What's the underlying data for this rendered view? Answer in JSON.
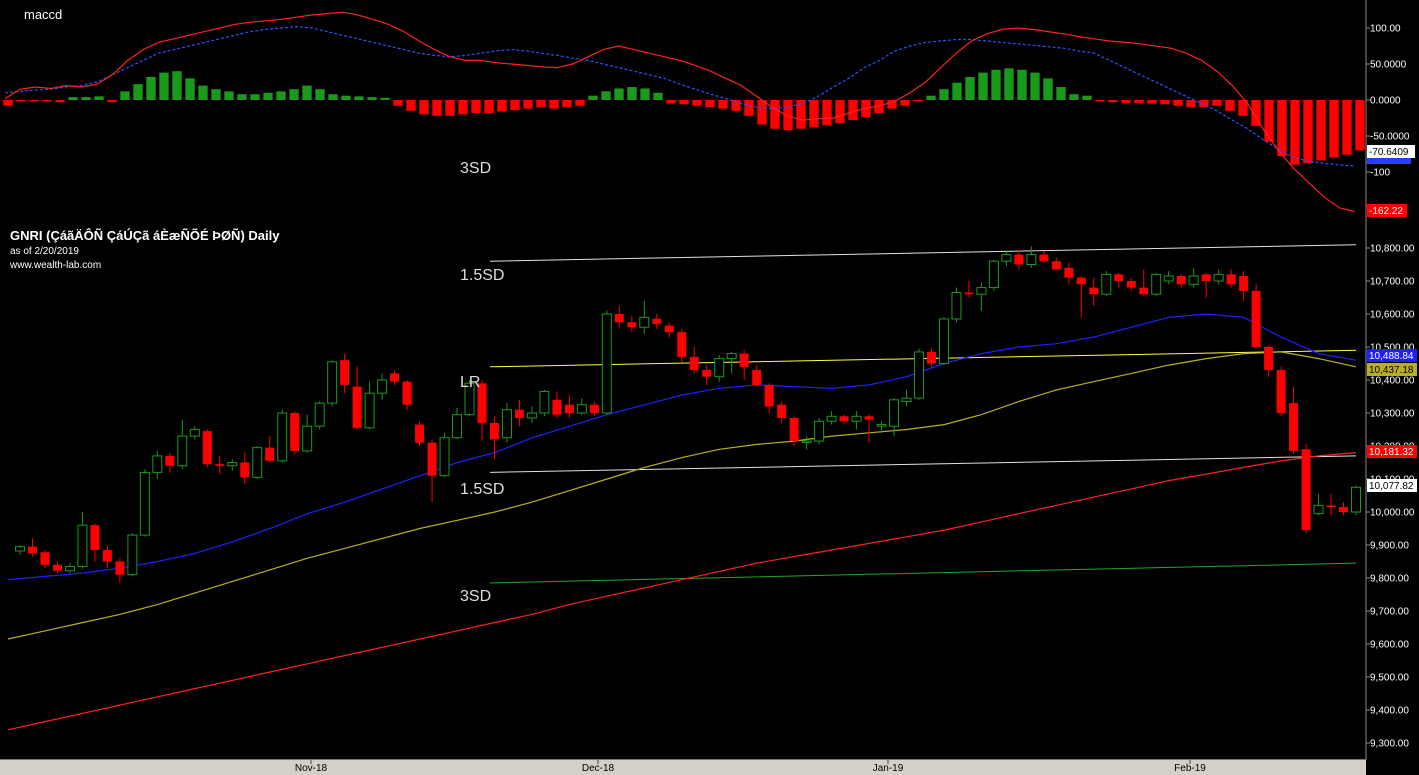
{
  "header": {
    "indicator_name": "maccd",
    "symbol_title": "GNRI (ÇáãÄÔÑ ÇáÚÇã áÈæÑÕÉ ÞØÑ) Daily",
    "as_of": "as of 2/20/2019",
    "source": "www.wealth-lab.com"
  },
  "colors": {
    "background": "#000000",
    "up_candle": "#1a9a1a",
    "down_candle": "#ff0000",
    "macd_line": "#ff2020",
    "signal_line": "#3050ff",
    "ma_short": "#2020ff",
    "ma_mid": "#b8b020",
    "ma_long": "#ff2020",
    "lr_line": "#ffff40",
    "band_line": "#e0e0e0",
    "lower_band": "#22a822",
    "axis_bg": "#d4d0c8"
  },
  "chart_data": [
    {
      "type": "bar",
      "name_label": "maccd",
      "yaxis_ticks": [
        "100.00",
        "50.0000",
        "0.0000",
        "-50.0000",
        "-100"
      ],
      "ylim": [
        -155,
        125
      ],
      "histogram": [
        -8,
        -2,
        -2,
        -2,
        -3,
        4,
        4,
        5,
        -3,
        12,
        22,
        32,
        38,
        40,
        30,
        20,
        15,
        12,
        8,
        8,
        10,
        12,
        15,
        20,
        15,
        8,
        6,
        5,
        4,
        3,
        -8,
        -15,
        -20,
        -22,
        -22,
        -20,
        -18,
        -18,
        -16,
        -14,
        -12,
        -10,
        -12,
        -10,
        -8,
        6,
        12,
        16,
        18,
        16,
        10,
        -5,
        -6,
        -8,
        -10,
        -12,
        -15,
        -22,
        -34,
        -40,
        -42,
        -40,
        -38,
        -35,
        -32,
        -28,
        -24,
        -18,
        -12,
        -8,
        -2,
        6,
        15,
        24,
        32,
        38,
        42,
        44,
        42,
        38,
        30,
        18,
        8,
        6,
        -2,
        -3,
        -4,
        -4,
        -5,
        -6,
        -8,
        -10,
        -10,
        -8,
        -15,
        -22,
        -36,
        -58,
        -78,
        -90,
        -88,
        -84,
        -80,
        -76,
        -70
      ],
      "macd": [
        2,
        15,
        18,
        16,
        20,
        18,
        22,
        35,
        55,
        70,
        80,
        85,
        90,
        95,
        100,
        105,
        108,
        110,
        112,
        115,
        118,
        120,
        122,
        118,
        112,
        105,
        95,
        82,
        70,
        60,
        55,
        55,
        52,
        50,
        48,
        46,
        45,
        50,
        60,
        70,
        75,
        70,
        65,
        60,
        55,
        48,
        40,
        30,
        20,
        5,
        -10,
        -22,
        -28,
        -26,
        -25,
        -18,
        -12,
        -8,
        -2,
        10,
        25,
        45,
        65,
        82,
        92,
        98,
        100,
        98,
        95,
        92,
        88,
        85,
        82,
        80,
        78,
        75,
        72,
        65,
        55,
        40,
        20,
        -5,
        -40,
        -70,
        -95,
        -115,
        -135,
        -150,
        -155
      ],
      "signal": [
        10,
        12,
        14,
        15,
        18,
        20,
        25,
        35,
        45,
        55,
        65,
        70,
        75,
        80,
        85,
        90,
        95,
        98,
        100,
        102,
        100,
        95,
        90,
        85,
        80,
        75,
        70,
        65,
        62,
        60,
        62,
        65,
        68,
        70,
        68,
        65,
        62,
        58,
        55,
        50,
        45,
        40,
        35,
        30,
        22,
        15,
        8,
        2,
        -5,
        -10,
        -12,
        -10,
        -5,
        5,
        18,
        30,
        45,
        55,
        68,
        75,
        80,
        82,
        84,
        84,
        82,
        80,
        78,
        76,
        74,
        72,
        68,
        65,
        55,
        45,
        35,
        25,
        15,
        5,
        -5,
        -15,
        -28,
        -40,
        -55,
        -68,
        -80,
        -85,
        -88,
        -90,
        -92
      ],
      "last_value_label": "-70.6409",
      "min_value_label": "-162.22"
    },
    {
      "type": "candlestick",
      "x_labels": [
        "Nov-18",
        "Dec-18",
        "Jan-19",
        "Feb-19"
      ],
      "yaxis_ticks": [
        "10,800.00",
        "10,700.00",
        "10,600.00",
        "10,500.00",
        "10,400.00",
        "10,300.00",
        "10,200.00",
        "10,100.00",
        "10,000.00",
        "9,900.00",
        "9,800.00",
        "9,700.00",
        "9,600.00",
        "9,500.00",
        "9,400.00",
        "9,300.00"
      ],
      "ylim": [
        9260,
        10870
      ],
      "candles": [
        [
          9882,
          9895,
          9870,
          9900
        ],
        [
          9895,
          9875,
          9865,
          9920
        ],
        [
          9878,
          9840,
          9830,
          9885
        ],
        [
          9840,
          9822,
          9815,
          9850
        ],
        [
          9822,
          9835,
          9815,
          9845
        ],
        [
          9835,
          9960,
          9828,
          10000
        ],
        [
          9960,
          9885,
          9850,
          9965
        ],
        [
          9885,
          9850,
          9830,
          9900
        ],
        [
          9850,
          9810,
          9785,
          9860
        ],
        [
          9810,
          9930,
          9805,
          9935
        ],
        [
          9930,
          10120,
          9925,
          10130
        ],
        [
          10120,
          10170,
          10100,
          10185
        ],
        [
          10170,
          10140,
          10120,
          10180
        ],
        [
          10140,
          10230,
          10130,
          10280
        ],
        [
          10230,
          10250,
          10220,
          10260
        ],
        [
          10245,
          10145,
          10135,
          10250
        ],
        [
          10145,
          10140,
          10115,
          10170
        ],
        [
          10140,
          10150,
          10125,
          10160
        ],
        [
          10150,
          10105,
          10085,
          10180
        ],
        [
          10105,
          10195,
          10100,
          10200
        ],
        [
          10195,
          10155,
          10150,
          10230
        ],
        [
          10155,
          10300,
          10150,
          10310
        ],
        [
          10300,
          10185,
          10175,
          10305
        ],
        [
          10185,
          10260,
          10180,
          10295
        ],
        [
          10260,
          10330,
          10250,
          10335
        ],
        [
          10330,
          10455,
          10320,
          10460
        ],
        [
          10460,
          10385,
          10360,
          10480
        ],
        [
          10380,
          10255,
          10250,
          10440
        ],
        [
          10255,
          10360,
          10250,
          10395
        ],
        [
          10360,
          10400,
          10340,
          10420
        ],
        [
          10420,
          10395,
          10385,
          10430
        ],
        [
          10395,
          10325,
          10310,
          10400
        ],
        [
          10265,
          10210,
          10200,
          10275
        ],
        [
          10210,
          10110,
          10030,
          10220
        ],
        [
          10110,
          10225,
          10105,
          10240
        ],
        [
          10225,
          10295,
          10220,
          10315
        ],
        [
          10295,
          10390,
          10290,
          10400
        ],
        [
          10390,
          10270,
          10215,
          10400
        ],
        [
          10270,
          10220,
          10160,
          10290
        ],
        [
          10225,
          10310,
          10210,
          10330
        ],
        [
          10310,
          10285,
          10260,
          10340
        ],
        [
          10285,
          10300,
          10270,
          10320
        ],
        [
          10300,
          10365,
          10290,
          10370
        ],
        [
          10340,
          10295,
          10285,
          10365
        ],
        [
          10325,
          10300,
          10285,
          10355
        ],
        [
          10300,
          10325,
          10295,
          10345
        ],
        [
          10325,
          10300,
          10290,
          10335
        ],
        [
          10300,
          10600,
          10295,
          10610
        ],
        [
          10600,
          10575,
          10560,
          10625
        ],
        [
          10575,
          10560,
          10545,
          10595
        ],
        [
          10560,
          10590,
          10540,
          10640
        ],
        [
          10585,
          10570,
          10555,
          10600
        ],
        [
          10565,
          10545,
          10530,
          10575
        ],
        [
          10545,
          10470,
          10455,
          10555
        ],
        [
          10470,
          10430,
          10420,
          10500
        ],
        [
          10430,
          10410,
          10385,
          10445
        ],
        [
          10410,
          10465,
          10395,
          10475
        ],
        [
          10465,
          10480,
          10420,
          10485
        ],
        [
          10480,
          10440,
          10400,
          10490
        ],
        [
          10430,
          10385,
          10380,
          10445
        ],
        [
          10385,
          10320,
          10300,
          10390
        ],
        [
          10325,
          10285,
          10270,
          10335
        ],
        [
          10285,
          10215,
          10200,
          10290
        ],
        [
          10215,
          10215,
          10190,
          10230
        ],
        [
          10215,
          10275,
          10205,
          10285
        ],
        [
          10275,
          10290,
          10265,
          10305
        ],
        [
          10290,
          10275,
          10265,
          10295
        ],
        [
          10275,
          10290,
          10250,
          10305
        ],
        [
          10290,
          10280,
          10210,
          10295
        ],
        [
          10260,
          10265,
          10240,
          10275
        ],
        [
          10260,
          10340,
          10230,
          10345
        ],
        [
          10335,
          10345,
          10320,
          10370
        ],
        [
          10345,
          10485,
          10340,
          10495
        ],
        [
          10485,
          10450,
          10440,
          10495
        ],
        [
          10450,
          10585,
          10445,
          10590
        ],
        [
          10585,
          10665,
          10575,
          10680
        ],
        [
          10665,
          10660,
          10650,
          10700
        ],
        [
          10660,
          10680,
          10610,
          10695
        ],
        [
          10680,
          10760,
          10670,
          10765
        ],
        [
          10760,
          10780,
          10745,
          10790
        ],
        [
          10780,
          10750,
          10735,
          10795
        ],
        [
          10750,
          10780,
          10740,
          10805
        ],
        [
          10780,
          10760,
          10755,
          10790
        ],
        [
          10760,
          10735,
          10735,
          10770
        ],
        [
          10740,
          10710,
          10690,
          10755
        ],
        [
          10710,
          10690,
          10590,
          10715
        ],
        [
          10680,
          10660,
          10625,
          10710
        ],
        [
          10660,
          10720,
          10655,
          10730
        ],
        [
          10720,
          10700,
          10680,
          10725
        ],
        [
          10700,
          10680,
          10670,
          10710
        ],
        [
          10680,
          10660,
          10655,
          10735
        ],
        [
          10660,
          10720,
          10655,
          10725
        ],
        [
          10700,
          10715,
          10690,
          10730
        ],
        [
          10715,
          10690,
          10680,
          10720
        ],
        [
          10690,
          10715,
          10680,
          10740
        ],
        [
          10720,
          10700,
          10650,
          10725
        ],
        [
          10700,
          10720,
          10690,
          10735
        ],
        [
          10720,
          10690,
          10680,
          10735
        ],
        [
          10715,
          10670,
          10640,
          10730
        ],
        [
          10670,
          10500,
          10495,
          10690
        ],
        [
          10500,
          10430,
          10410,
          10505
        ],
        [
          10430,
          10300,
          10290,
          10440
        ],
        [
          10330,
          10185,
          10175,
          10380
        ],
        [
          10190,
          9945,
          9935,
          10205
        ],
        [
          9995,
          10020,
          9990,
          10055
        ],
        [
          10020,
          10015,
          9990,
          10055
        ],
        [
          10015,
          10000,
          9990,
          10030
        ],
        [
          10000,
          10075,
          9990,
          10080
        ]
      ],
      "ma_short": [
        9795,
        9805,
        9815,
        9830,
        9850,
        9875,
        9910,
        9950,
        9995,
        10030,
        10070,
        10110,
        10150,
        10180,
        10225,
        10260,
        10295,
        10325,
        10355,
        10375,
        10385,
        10380,
        10375,
        10385,
        10410,
        10450,
        10480,
        10500,
        10510,
        10530,
        10560,
        10590,
        10600,
        10590,
        10530,
        10480,
        10460
      ],
      "ma_mid": [
        9615,
        9640,
        9665,
        9690,
        9720,
        9755,
        9790,
        9825,
        9860,
        9890,
        9920,
        9950,
        9975,
        10000,
        10030,
        10065,
        10100,
        10135,
        10165,
        10190,
        10205,
        10215,
        10230,
        10240,
        10250,
        10265,
        10295,
        10335,
        10370,
        10395,
        10420,
        10445,
        10465,
        10480,
        10485,
        10465,
        10440
      ],
      "ma_long": [
        9340,
        9365,
        9390,
        9415,
        9440,
        9465,
        9490,
        9515,
        9540,
        9565,
        9590,
        9615,
        9640,
        9665,
        9690,
        9720,
        9745,
        9770,
        9795,
        9820,
        9845,
        9865,
        9885,
        9905,
        9925,
        9945,
        9970,
        9995,
        10020,
        10045,
        10070,
        10095,
        10115,
        10135,
        10155,
        10170,
        10180
      ],
      "lr": [
        10440,
        10490
      ],
      "band_upper_3sd": [
        10760,
        10810
      ],
      "band_lower_1_5sd": [
        10120,
        10170
      ],
      "band_lower_3sd": [
        9785,
        9845
      ],
      "band_labels": [
        "3SD",
        "1.5SD",
        "LR",
        "1.5SD",
        "3SD"
      ],
      "value_badges": [
        "10,488.84",
        "10,437.18",
        "10,181.32",
        "10,077.82"
      ]
    }
  ]
}
